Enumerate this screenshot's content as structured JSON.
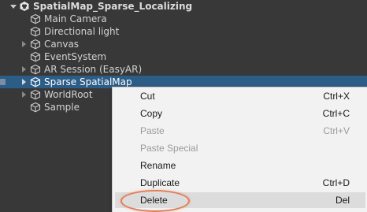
{
  "hierarchy": {
    "scene": "SpatialMap_Sparse_Localizing",
    "items": [
      {
        "label": "Main Camera",
        "expandable": false
      },
      {
        "label": "Directional light",
        "expandable": false
      },
      {
        "label": "Canvas",
        "expandable": true
      },
      {
        "label": "EventSystem",
        "expandable": false
      },
      {
        "label": "AR Session (EasyAR)",
        "expandable": true
      },
      {
        "label": "Sparse SpatialMap",
        "expandable": true,
        "selected": true
      },
      {
        "label": "WorldRoot",
        "expandable": true
      },
      {
        "label": "Sample",
        "expandable": false
      }
    ]
  },
  "context_menu": {
    "items": [
      {
        "label": "Cut",
        "shortcut": "Ctrl+X",
        "enabled": true
      },
      {
        "label": "Copy",
        "shortcut": "Ctrl+C",
        "enabled": true
      },
      {
        "label": "Paste",
        "shortcut": "Ctrl+V",
        "enabled": false
      },
      {
        "label": "Paste Special",
        "shortcut": "",
        "enabled": false
      },
      {
        "label": "Rename",
        "shortcut": "",
        "enabled": true
      },
      {
        "label": "Duplicate",
        "shortcut": "Ctrl+D",
        "enabled": true
      },
      {
        "label": "Delete",
        "shortcut": "Del",
        "enabled": true,
        "highlighted": true
      }
    ]
  },
  "colors": {
    "panel_bg": "#383838",
    "selection": "#2c5d87",
    "menu_bg": "#f2f2f2",
    "annotation": "#e07d55"
  }
}
